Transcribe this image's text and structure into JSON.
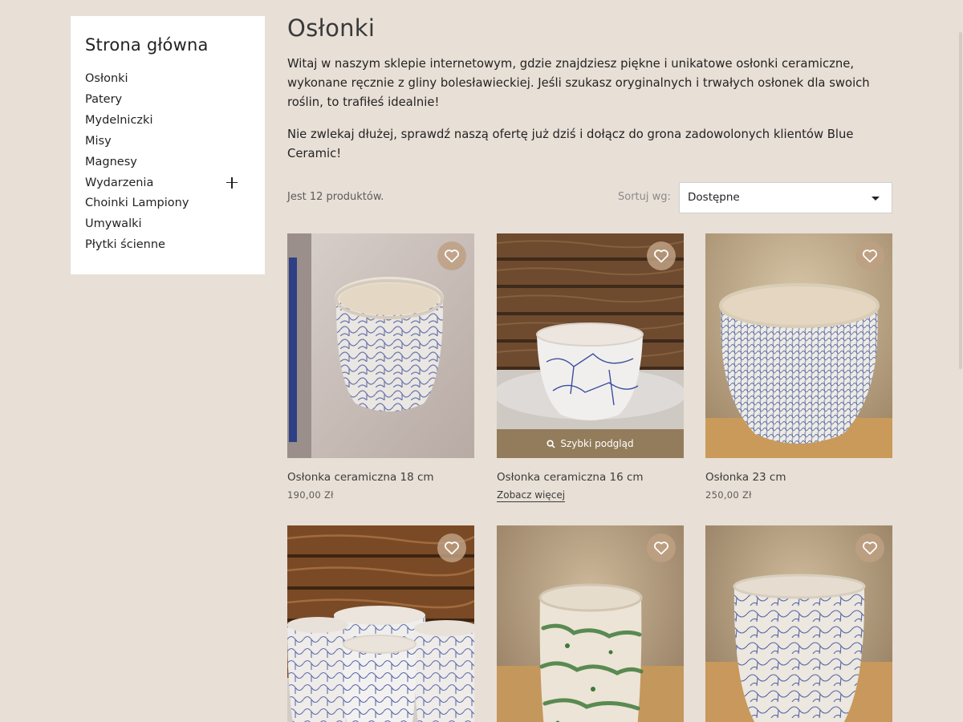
{
  "sidebar": {
    "title": "Strona główna",
    "items": [
      {
        "label": "Osłonki"
      },
      {
        "label": "Patery"
      },
      {
        "label": "Mydelniczki"
      },
      {
        "label": "Misy"
      },
      {
        "label": "Magnesy"
      },
      {
        "label": "Wydarzenia",
        "expandable": true
      },
      {
        "label": "Choinki Lampiony"
      },
      {
        "label": "Umywalki"
      },
      {
        "label": "Płytki ścienne"
      }
    ]
  },
  "main": {
    "title": "Osłonki",
    "description": [
      "Witaj w naszym sklepie internetowym, gdzie znajdziesz piękne i unikatowe osłonki ceramiczne, wykonane ręcznie z gliny bolesławieckiej. Jeśli szukasz oryginalnych i trwałych osłonek dla swoich roślin, to trafiłeś idealnie!",
      "Nie zwlekaj dłużej, sprawdź naszą ofertę już dziś i dołącz do grona zadowolonych klientów Blue Ceramic!"
    ]
  },
  "toolbar": {
    "count": "Jest 12 produktów.",
    "sort_label": "Sortuj wg:",
    "sort_value": "Dostępne"
  },
  "products": [
    {
      "name": "Osłonka ceramiczna 18 cm",
      "price": "190,00 Zł",
      "icon": "heart-icon"
    },
    {
      "name": "Osłonka ceramiczna 16 cm",
      "more": "Zobacz więcej",
      "quick_view": "Szybki podgląd",
      "icon": "heart-icon"
    },
    {
      "name": "Osłonka 23 cm",
      "price": "250,00 Zł",
      "icon": "heart-icon"
    },
    {
      "name": "",
      "icon": "heart-icon"
    },
    {
      "name": "",
      "icon": "heart-icon"
    },
    {
      "name": "",
      "icon": "heart-icon"
    }
  ],
  "colors": {
    "background": "#e8dfd6",
    "panel": "#ffffff",
    "text": "#232323",
    "quick_view_bg": "#8c7350",
    "favorite_bg": "#bea082",
    "glaze_blue": "#3b4f9e",
    "glaze_green": "#3f7a3a"
  }
}
